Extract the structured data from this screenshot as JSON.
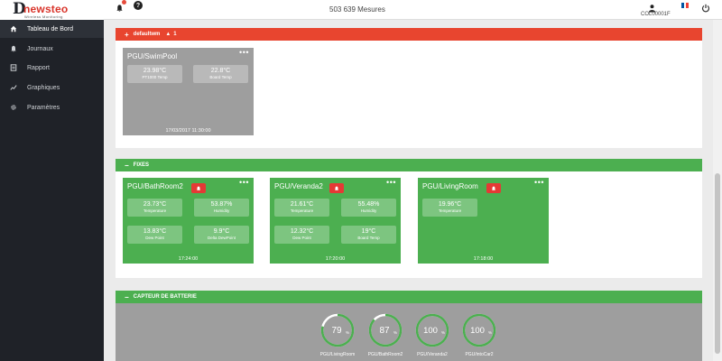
{
  "logo": {
    "text": "newsteo",
    "letter": "D",
    "subtitle": "Wireless Monitoring"
  },
  "sidebar": {
    "items": [
      {
        "label": "Tableau de Bord",
        "icon": "home-icon",
        "active": true
      },
      {
        "label": "Journaux",
        "icon": "bell-icon",
        "active": false
      },
      {
        "label": "Rapport",
        "icon": "report-icon",
        "active": false
      },
      {
        "label": "Graphiques",
        "icon": "chart-icon",
        "active": false
      },
      {
        "label": "Paramètres",
        "icon": "gear-icon",
        "active": false
      }
    ]
  },
  "topbar": {
    "title": "503 639 Mesures",
    "help": "?",
    "username": "COL00001F",
    "flag_colors": [
      "#0055a4",
      "#ffffff",
      "#ef4135"
    ]
  },
  "groups": {
    "default": {
      "toggle": "+",
      "name": "defaultwm",
      "warning_icon": "▲",
      "warning_count": "1",
      "color": "#e8452f",
      "cards": [
        {
          "title": "PGU/SwimPool",
          "menu": "•••",
          "metrics": [
            {
              "value": "23.98°C",
              "label": "PT1000 Temp"
            },
            {
              "value": "22.8°C",
              "label": "Board Temp"
            }
          ],
          "time": "17/03/2017 11:30:00"
        }
      ]
    },
    "fixes": {
      "toggle": "−",
      "name": "FIXES",
      "color": "#4caf50",
      "cards": [
        {
          "title": "PGU/BathRoom2",
          "menu": "•••",
          "metrics": [
            {
              "value": "23.73°C",
              "label": "Temperature"
            },
            {
              "value": "53.87%",
              "label": "Humidity"
            },
            {
              "value": "13.83°C",
              "label": "Dew Point"
            },
            {
              "value": "9.9°C",
              "label": "Delta DewPoint"
            }
          ],
          "time": "17:24:00"
        },
        {
          "title": "PGU/Veranda2",
          "menu": "•••",
          "metrics": [
            {
              "value": "21.61°C",
              "label": "Temperature"
            },
            {
              "value": "55.48%",
              "label": "Humidity"
            },
            {
              "value": "12.32°C",
              "label": "Dew Point"
            },
            {
              "value": "19°C",
              "label": "Board Temp"
            }
          ],
          "time": "17:20:00"
        },
        {
          "title": "PGU/LivingRoom",
          "menu": "•••",
          "metrics": [
            {
              "value": "19.96°C",
              "label": "Temperature"
            }
          ],
          "time": "17:18:00"
        }
      ]
    },
    "battery": {
      "toggle": "−",
      "name": "CAPTEUR DE BATTERIE",
      "color": "#4caf50",
      "gauges": [
        {
          "value": "79",
          "unit": "%",
          "percent": 79,
          "label": "PGU/LivingRoom"
        },
        {
          "value": "87",
          "unit": "%",
          "percent": 87,
          "label": "PGU/BathRoom2"
        },
        {
          "value": "100",
          "unit": "%",
          "percent": 100,
          "label": "PGU/Veranda2"
        },
        {
          "value": "100",
          "unit": "%",
          "percent": 100,
          "label": "PGU/intoCar2"
        }
      ]
    }
  }
}
